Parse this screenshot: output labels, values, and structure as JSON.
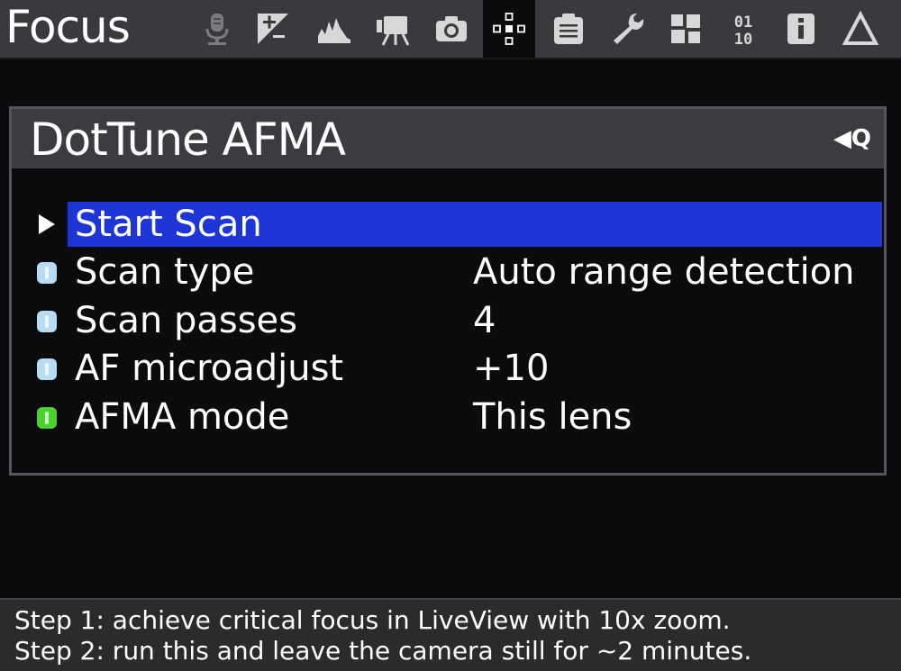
{
  "header": {
    "title": "Focus",
    "tabs": [
      {
        "icon": "audio-microphone-icon",
        "active": false
      },
      {
        "icon": "exposure-compensation-icon",
        "active": false
      },
      {
        "icon": "histogram-icon",
        "active": false
      },
      {
        "icon": "movie-camera-icon",
        "active": false
      },
      {
        "icon": "camera-icon",
        "active": false
      },
      {
        "icon": "focus-icon",
        "active": true
      },
      {
        "icon": "clipboard-icon",
        "active": false
      },
      {
        "icon": "wrench-icon",
        "active": false
      },
      {
        "icon": "modules-icon",
        "active": false
      },
      {
        "icon": "debug-binary-icon",
        "active": false
      },
      {
        "icon": "info-icon",
        "active": false
      },
      {
        "icon": "delta-icon",
        "active": false
      }
    ]
  },
  "panel": {
    "title": "DotTune AFMA",
    "hint": "◀Q",
    "items": [
      {
        "label": "Start Scan",
        "value": "",
        "marker": "arrow",
        "selected": true
      },
      {
        "label": "Scan type",
        "value": "Auto range detection",
        "marker": "blue"
      },
      {
        "label": "Scan passes",
        "value": "4",
        "marker": "blue"
      },
      {
        "label": "AF microadjust",
        "value": "+10",
        "marker": "blue"
      },
      {
        "label": "AFMA mode",
        "value": "This lens",
        "marker": "green"
      }
    ]
  },
  "footer": {
    "line1": "Step 1: achieve critical focus in LiveView with 10x zoom.",
    "line2": "Step 2: run this and leave the camera still for ~2 minutes."
  },
  "colors": {
    "selection": "#1f36d6",
    "marker_blue": "#b9dcf6",
    "marker_green": "#4cd22e"
  }
}
